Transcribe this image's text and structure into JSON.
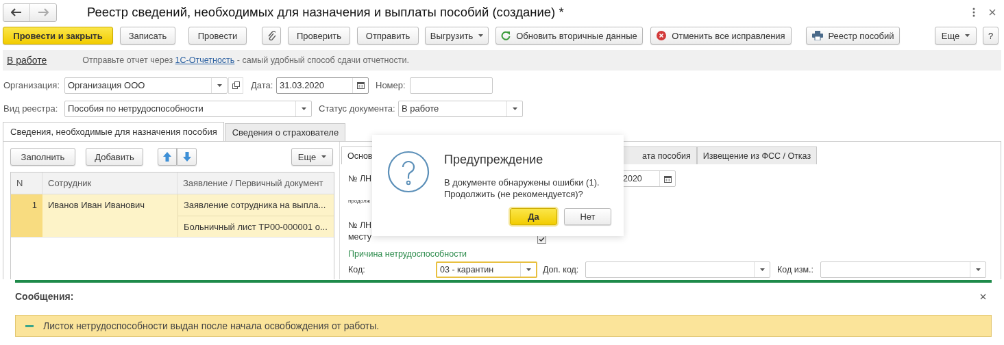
{
  "window": {
    "title": "Реестр сведений, необходимых для назначения и выплаты пособий (создание) *"
  },
  "toolbar": {
    "buttons": [
      {
        "kind": "primary",
        "label": "Провести и закрыть"
      },
      {
        "kind": "plain",
        "label": "Записать"
      },
      {
        "kind": "plain",
        "label": "Провести"
      },
      {
        "kind": "attach"
      },
      {
        "kind": "plain",
        "label": "Проверить"
      },
      {
        "kind": "plain",
        "label": "Отправить"
      },
      {
        "kind": "dropdown",
        "label": "Выгрузить"
      },
      {
        "kind": "refresh",
        "label": "Обновить вторичные данные"
      },
      {
        "kind": "cancel",
        "label": "Отменить все исправления"
      },
      {
        "kind": "print",
        "label": "Реестр пособий"
      },
      {
        "kind": "dropdown",
        "label": "Еще"
      },
      {
        "kind": "plain",
        "label": "?"
      }
    ]
  },
  "info_bar": {
    "status_link": "В работе",
    "message": {
      "before": "Отправьте отчет через ",
      "link": "1С-Отчетность",
      "after": " - самый удобный способ сдачи отчетности."
    }
  },
  "header_fields": {
    "organization": {
      "label": "Организация:",
      "value": "Организация ООО"
    },
    "date": {
      "label": "Дата:",
      "value": "31.03.2020"
    },
    "number": {
      "label": "Номер:"
    },
    "register_type": {
      "label": "Вид реестра:",
      "value": "Пособия по нетрудоспособности"
    },
    "document_status": {
      "label": "Статус документа:",
      "value": "В работе"
    }
  },
  "tabs": [
    {
      "label": "Сведения, необходимые для назначения пособия",
      "selected": true
    },
    {
      "label": "Сведения о страхователе",
      "selected": false
    }
  ],
  "left_panel": {
    "buttons": [
      {
        "kind": "plain",
        "label": "Заполнить"
      },
      {
        "kind": "plain",
        "label": "Добавить"
      },
      {
        "kind": "up"
      },
      {
        "kind": "down"
      },
      {
        "kind": "dropdown",
        "label": "Еще"
      }
    ],
    "table": {
      "columns": [
        "N",
        "Сотрудник",
        "Заявление / Первичный документ"
      ],
      "rows": [
        {
          "n": "1",
          "employee": "Иванов Иван Иванович",
          "documents": [
            "Заявление сотрудника на выпла...",
            "Больничный лист ТР00-000001 о..."
          ],
          "selected": true
        }
      ]
    }
  },
  "right_panel": {
    "tabs": [
      {
        "label": "Основ",
        "selected": true
      },
      {
        "label": "ата пособия",
        "selected": false
      },
      {
        "label": "Извещение из ФСС / Отказ",
        "selected": false
      }
    ],
    "sick_leave_label": "№ ЛН",
    "date_value": "2020",
    "small_label": "продолж",
    "sick_leave_label_2": "№ ЛН",
    "place_label": "месту",
    "checkbox": {
      "checked": true
    },
    "section_title": "Причина нетрудоспособности",
    "code": {
      "label": "Код:",
      "value": "03 - карантин",
      "focused": true
    },
    "extra_code": {
      "label": "Доп. код:"
    },
    "change_code": {
      "label": "Код изм.:"
    }
  },
  "dialog": {
    "title": "Предупреждение",
    "message": "В документе обнаружены ошибки (1).\nПродолжить (не рекомендуется)?",
    "buttons": [
      {
        "label": "Да",
        "default": true
      },
      {
        "label": "Нет",
        "default": false
      }
    ]
  },
  "messages": {
    "title": "Сообщения:",
    "items": [
      {
        "text": "Листок нетрудоспособности выдан после начала освобождения от работы."
      }
    ]
  }
}
